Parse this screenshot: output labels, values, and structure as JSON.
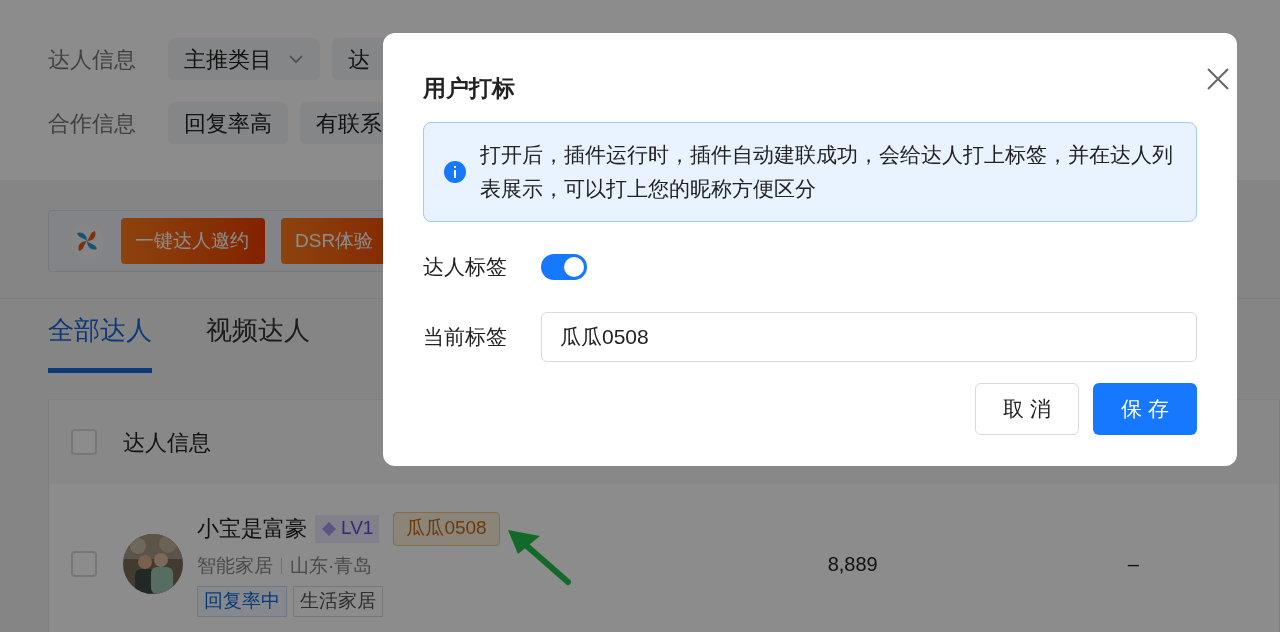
{
  "filters": [
    {
      "label": "达人信息",
      "chips": [
        {
          "text": "主推类目",
          "dropdown": true
        },
        {
          "text": "达",
          "dropdown": false
        }
      ]
    },
    {
      "label": "合作信息",
      "chips": [
        {
          "text": "回复率高",
          "dropdown": false
        },
        {
          "text": "有联系",
          "dropdown": false
        }
      ]
    }
  ],
  "toolbar": {
    "buttons": [
      "一键达人邀约",
      "DSR体验"
    ]
  },
  "tabs": [
    {
      "label": "全部达人",
      "selected": true
    },
    {
      "label": "视频达人",
      "selected": false
    }
  ],
  "table": {
    "header_checked": false,
    "columns": [
      "达人信息"
    ],
    "rows": [
      {
        "checked": false,
        "name": "小宝是富豪",
        "level": "LV1",
        "mark": "瓜瓜0508",
        "category": "智能家居",
        "location": "山东·青岛",
        "tags": [
          {
            "text": "回复率中",
            "kind": "status"
          },
          {
            "text": "生活家居",
            "kind": "category"
          }
        ],
        "column_2": "8,889",
        "column_3": "–"
      }
    ]
  },
  "dialog": {
    "title": "用户打标",
    "info": "打开后，插件运行时，插件自动建联成功，会给达人打上标签，并在达人列表展示，可以打上您的昵称方便区分",
    "switch": {
      "label": "达人标签",
      "on": true
    },
    "field": {
      "label": "当前标签",
      "value": "瓜瓜0508"
    },
    "buttons": [
      {
        "text": "取 消",
        "kind": "secondary"
      },
      {
        "text": "保 存",
        "kind": "primary"
      }
    ]
  }
}
